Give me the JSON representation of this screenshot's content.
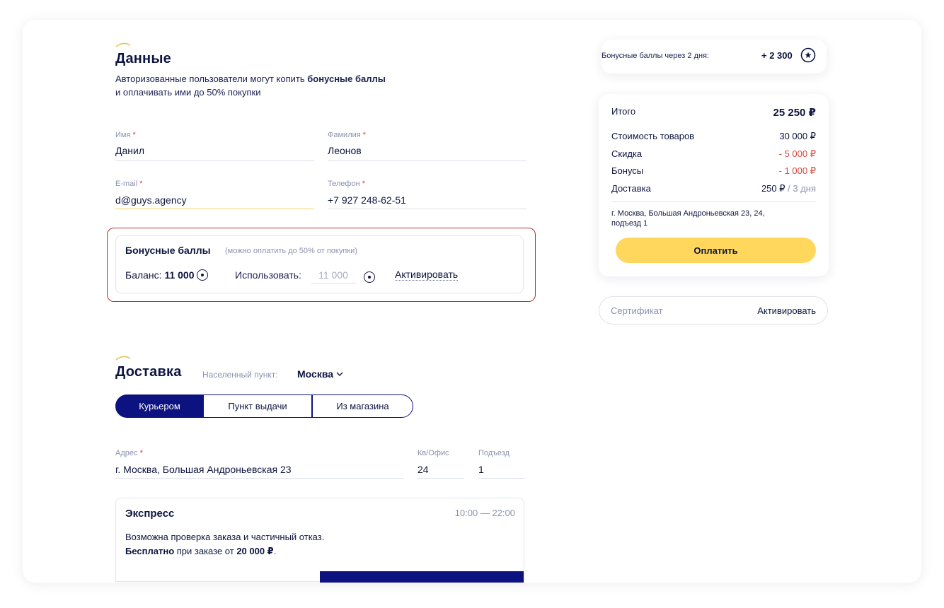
{
  "data_section": {
    "title": "Данные",
    "subtitle_line1_pre": "Авторизованные пользователи могут копить ",
    "subtitle_line1_bold": "бонусные баллы",
    "subtitle_line2": "и оплачивать ими до 50% покупки",
    "first_name": {
      "label": "Имя",
      "value": "Данил"
    },
    "last_name": {
      "label": "Фамилия",
      "value": "Леонов"
    },
    "email": {
      "label": "E-mail",
      "value": "d@guys.agency"
    },
    "phone": {
      "label": "Телефон",
      "value": "+7 927 248-62-51"
    },
    "required_mark": "*"
  },
  "bonus": {
    "title": "Бонусные баллы",
    "note": "(можно оплатить до 50% от покупки)",
    "balance_label": "Баланс:",
    "balance_value": "11 000",
    "use_label": "Использовать:",
    "use_placeholder": "11 000",
    "activate": "Активировать"
  },
  "delivery": {
    "title": "Доставка",
    "locality_label": "Населенный пункт:",
    "locality_value": "Москва",
    "tabs": [
      "Курьером",
      "Пункт выдачи",
      "Из магазина"
    ],
    "active_tab": "Курьером",
    "address": {
      "label": "Адрес",
      "value": "г. Москва, Большая Андроньевская 23"
    },
    "office": {
      "label": "Кв/Офис",
      "value": "24"
    },
    "entrance": {
      "label": "Подъезд",
      "value": "1"
    },
    "express": {
      "title": "Экспресс",
      "hours": "10:00 — 22:00",
      "line1": "Возможна проверка заказа и частичный отказ.",
      "line2_bold": "Бесплатно",
      "line2_mid": " при заказе от ",
      "line2_amount": "20 000 ₽",
      "line2_end": "."
    }
  },
  "summary": {
    "bonus_future_label": "Бонусные баллы через 2 дня:",
    "bonus_future_value": "+ 2 300",
    "total_label": "Итого",
    "total_value": "25 250 ₽",
    "items_label": "Стоимость товаров",
    "items_value": "30 000 ₽",
    "discount_label": "Скидка",
    "discount_value": "- 5 000 ₽",
    "bonuses_label": "Бонусы",
    "bonuses_value": "- 1 000 ₽",
    "delivery_label": "Доставка",
    "delivery_price": "250 ₽",
    "delivery_days": " / 3 дня",
    "address_line1": "г. Москва, Большая Андроньевская 23, 24,",
    "address_line2": "подъезд 1",
    "pay_button": "Оплатить"
  },
  "certificate": {
    "label": "Сертификат",
    "activate": "Активировать"
  },
  "colors": {
    "navy": "#0c1280",
    "accent_yellow": "#ffd75c",
    "highlight_red": "#b52f2f",
    "discount_red": "#d8453a"
  }
}
